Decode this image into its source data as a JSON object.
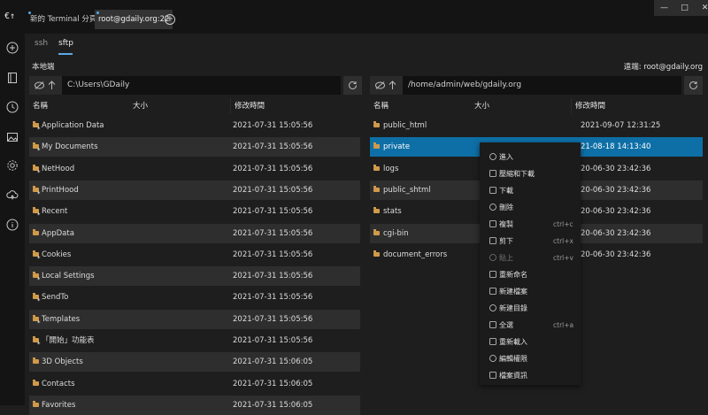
{
  "app": {
    "logo": "€↑"
  },
  "sidebar": {
    "icons": [
      "plus-circle-icon",
      "notebook-icon",
      "clock-icon",
      "image-icon",
      "gear-icon",
      "cloud-icon",
      "info-icon"
    ]
  },
  "tabs": [
    {
      "label": "新的 Terminal 分頁"
    },
    {
      "label": "root@gdaily.org:22"
    }
  ],
  "window": {
    "minimize": "—",
    "maximize": "□",
    "close": "✕"
  },
  "subtabs": [
    "ssh",
    "sftp"
  ],
  "local": {
    "title": "本地端",
    "path": "C:\\Users\\GDaily",
    "columns": [
      "名稱",
      "大小",
      "修改時間"
    ],
    "rows": [
      {
        "name": "Application Data",
        "date": "2021-07-31 15:05:56",
        "link": true
      },
      {
        "name": "My Documents",
        "date": "2021-07-31 15:05:56",
        "link": true
      },
      {
        "name": "NetHood",
        "date": "2021-07-31 15:05:56",
        "link": true
      },
      {
        "name": "PrintHood",
        "date": "2021-07-31 15:05:56",
        "link": true
      },
      {
        "name": "Recent",
        "date": "2021-07-31 15:05:56",
        "link": true
      },
      {
        "name": "AppData",
        "date": "2021-07-31 15:05:56",
        "link": false
      },
      {
        "name": "Cookies",
        "date": "2021-07-31 15:05:56",
        "link": true
      },
      {
        "name": "Local Settings",
        "date": "2021-07-31 15:05:56",
        "link": true
      },
      {
        "name": "SendTo",
        "date": "2021-07-31 15:05:56",
        "link": true
      },
      {
        "name": "Templates",
        "date": "2021-07-31 15:05:56",
        "link": true
      },
      {
        "name": "「開始」功能表",
        "date": "2021-07-31 15:05:56",
        "link": true
      },
      {
        "name": "3D Objects",
        "date": "2021-07-31 15:06:05",
        "link": false
      },
      {
        "name": "Contacts",
        "date": "2021-07-31 15:06:05",
        "link": false
      },
      {
        "name": "Favorites",
        "date": "2021-07-31 15:06:05",
        "link": false
      }
    ]
  },
  "remote": {
    "title": "遠端: root@gdaily.org",
    "path": "/home/admin/web/gdaily.org",
    "columns": [
      "名稱",
      "大小",
      "修改時間"
    ],
    "rows": [
      {
        "name": "public_html",
        "date": "2021-09-07 12:31:25"
      },
      {
        "name": "private",
        "date": "21-08-18 14:13:40"
      },
      {
        "name": "logs",
        "date": "20-06-30 23:42:36"
      },
      {
        "name": "public_shtml",
        "date": "20-06-30 23:42:36"
      },
      {
        "name": "stats",
        "date": "20-06-30 23:42:36"
      },
      {
        "name": "cgi-bin",
        "date": "20-06-30 23:42:36"
      },
      {
        "name": "document_errors",
        "date": "20-06-30 23:42:36"
      }
    ]
  },
  "context_menu": [
    {
      "label": "進入",
      "shortcut": "",
      "icon": "enter-icon"
    },
    {
      "label": "壓縮和下載",
      "shortcut": "",
      "icon": "cloud-download-icon"
    },
    {
      "label": "下載",
      "shortcut": "",
      "icon": "download-icon"
    },
    {
      "label": "刪除",
      "shortcut": "",
      "icon": "delete-icon"
    },
    {
      "label": "複製",
      "shortcut": "ctrl+c",
      "icon": "copy-icon"
    },
    {
      "label": "剪下",
      "shortcut": "ctrl+x",
      "icon": "cut-icon"
    },
    {
      "label": "貼上",
      "shortcut": "ctrl+v",
      "icon": "paste-icon",
      "disabled": true
    },
    {
      "label": "重新命名",
      "shortcut": "",
      "icon": "rename-icon"
    },
    {
      "label": "新建檔案",
      "shortcut": "",
      "icon": "new-file-icon"
    },
    {
      "label": "新建目錄",
      "shortcut": "",
      "icon": "new-folder-icon"
    },
    {
      "label": "全選",
      "shortcut": "ctrl+a",
      "icon": "select-all-icon"
    },
    {
      "label": "重新載入",
      "shortcut": "",
      "icon": "reload-icon"
    },
    {
      "label": "編輯權限",
      "shortcut": "",
      "icon": "lock-icon"
    },
    {
      "label": "檔案資訊",
      "shortcut": "",
      "icon": "info-icon"
    }
  ]
}
